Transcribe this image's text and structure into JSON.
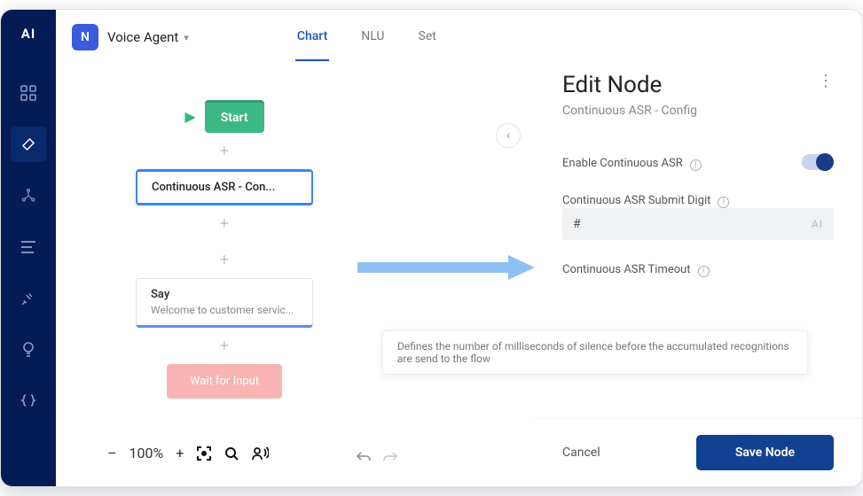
{
  "logo": "AI",
  "agent": {
    "chip": "N",
    "name": "Voice Agent"
  },
  "tabs": [
    {
      "label": "Chart",
      "active": true
    },
    {
      "label": "NLU"
    },
    {
      "label": "Set"
    }
  ],
  "flow": {
    "start": "Start",
    "node1": "Continuous ASR - Con...",
    "node2_title": "Say",
    "node2_sub": "Welcome to customer servic...",
    "node3": "Wait for Input"
  },
  "panel": {
    "title": "Edit Node",
    "subtitle": "Continuous ASR - Config",
    "field1": "Enable Continuous ASR",
    "field2": "Continuous ASR Submit Digit",
    "field2_value": "#",
    "field3": "Continuous ASR Timeout",
    "input_ai": "AI",
    "cancel": "Cancel",
    "save": "Save Node"
  },
  "tooltip": "Defines the number of milliseconds of silence before the accumulated recognitions are send to the flow",
  "zoom": {
    "minus": "–",
    "level": "100%",
    "plus": "+"
  }
}
